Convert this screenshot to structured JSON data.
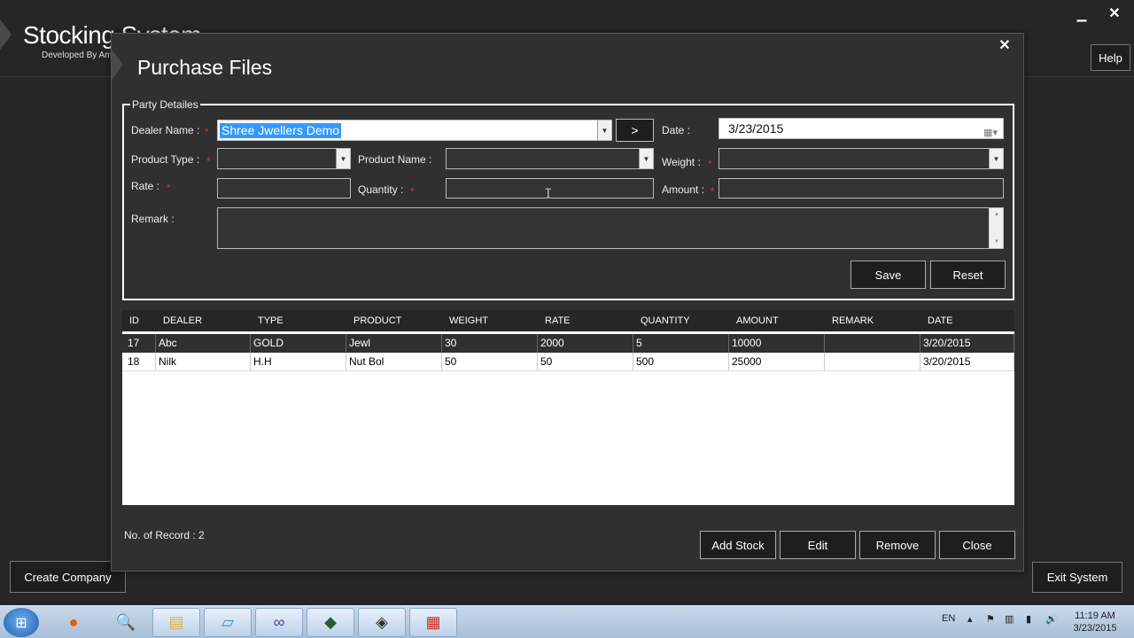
{
  "app": {
    "title": "Stocking System",
    "subtitle": "Developed By Am",
    "min_glyph": "▁",
    "close_glyph": "✕",
    "help_label": "Help",
    "create_company_label": "Create Company",
    "exit_label": "Exit System"
  },
  "dialog": {
    "title": "Purchase Files",
    "close_glyph": "✕",
    "group_title": "Party Detailes",
    "labels": {
      "dealer": "Dealer Name :",
      "date": "Date :",
      "product_type": "Product Type :",
      "product_name": "Product Name :",
      "weight": "Weight :",
      "rate": "Rate :",
      "quantity": "Quantity :",
      "amount": "Amount :",
      "remark": "Remark :"
    },
    "required_mark": "*",
    "dealer_value": "Shree Jwellers Demo",
    "date_value": "3/23/2015",
    "go_label": ">",
    "save_label": "Save",
    "reset_label": "Reset",
    "records_label": "No. of Record : 2",
    "add_stock_label": "Add Stock",
    "edit_label": "Edit",
    "remove_label": "Remove",
    "close_label": "Close"
  },
  "grid": {
    "columns": [
      "ID",
      "DEALER",
      "TYPE",
      "PRODUCT",
      "WEIGHT",
      "RATE",
      "QUANTITY",
      "AMOUNT",
      "REMARK",
      "DATE"
    ],
    "rows": [
      [
        "17",
        "Abc",
        "GOLD",
        "Jewl",
        "30",
        "2000",
        "5",
        "10000",
        "",
        "3/20/2015"
      ],
      [
        "18",
        "Nilk",
        "H.H",
        "Nut Bol",
        "50",
        "50",
        "500",
        "25000",
        "",
        "3/20/2015"
      ]
    ]
  },
  "taskbar": {
    "lang": "EN",
    "time": "11:19 AM",
    "date": "3/23/2015"
  }
}
